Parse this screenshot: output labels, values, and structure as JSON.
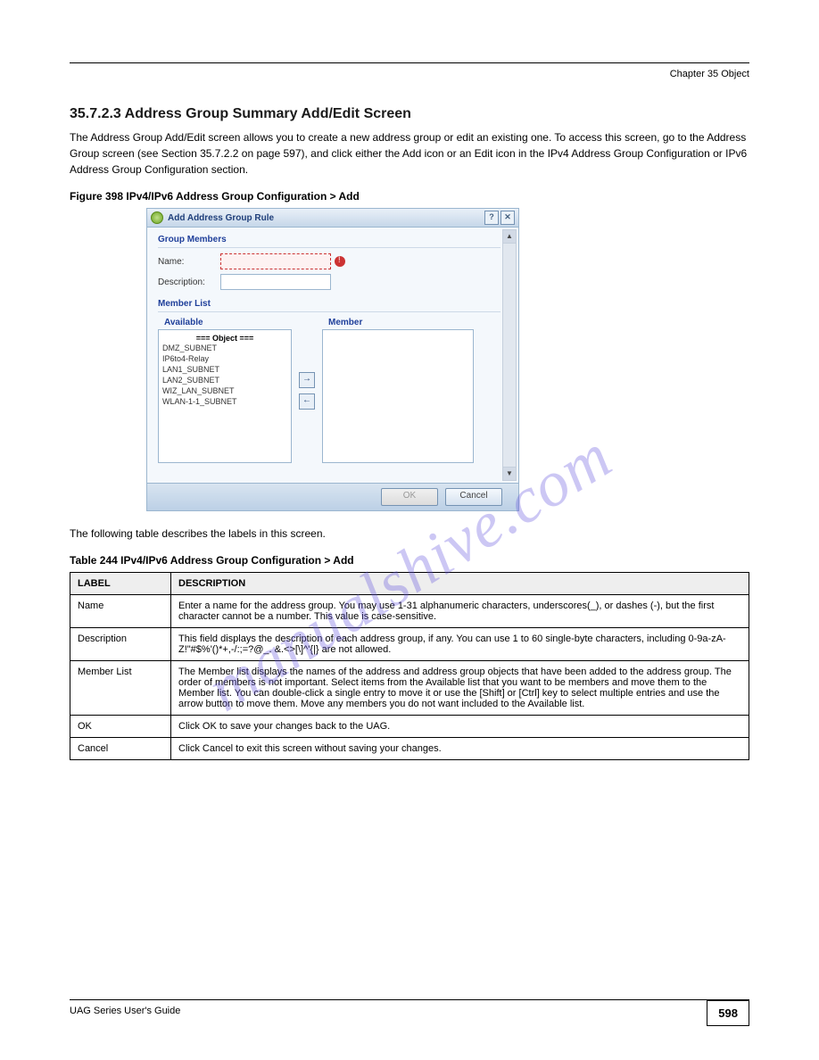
{
  "header": {
    "chapter": "Chapter 35 Object"
  },
  "section": {
    "heading": "35.7.2.3  Address Group Summary Add/Edit Screen",
    "intro": "The Address Group Add/Edit screen allows you to create a new address group or edit an existing one. To access this screen, go to the Address Group screen (see Section 35.7.2.2 on page 597), and click either the Add icon or an Edit icon in the IPv4 Address Group Configuration or IPv6 Address Group Configuration section."
  },
  "figure": {
    "caption": "Figure 398   IPv4/IPv6 Address Group Configuration > Add"
  },
  "dialog": {
    "title": "Add Address Group Rule",
    "groupMembersLabel": "Group Members",
    "nameLabel": "Name:",
    "descLabel": "Description:",
    "memberListLabel": "Member List",
    "availableLabel": "Available",
    "memberLabel": "Member",
    "objectDivider": "=== Object ===",
    "available": [
      "DMZ_SUBNET",
      "IP6to4-Relay",
      "LAN1_SUBNET",
      "LAN2_SUBNET",
      "WIZ_LAN_SUBNET",
      "WLAN-1-1_SUBNET"
    ],
    "okLabel": "OK",
    "cancelLabel": "Cancel"
  },
  "tableIntro": "The following table describes the labels in this screen.",
  "table": {
    "caption": "Table 244   IPv4/IPv6 Address Group Configuration > Add",
    "headers": [
      "LABEL",
      "DESCRIPTION"
    ],
    "rows": [
      {
        "label": "Name",
        "desc": "Enter a name for the address group. You may use 1-31 alphanumeric characters, underscores(_), or dashes (-), but the first character cannot be a number. This value is case-sensitive."
      },
      {
        "label": "Description",
        "desc": "This field displays the description of each address group, if any. You can use 1 to 60 single-byte characters, including 0-9a-zA-Z!\"#$%'()*+,-/:;=?@_. &.<>[\\]^'{|} are not allowed."
      },
      {
        "label": "Member List",
        "desc": "The Member list displays the names of the address and address group objects that have been added to the address group. The order of members is not important. Select items from the Available list that you want to be members and move them to the Member list. You can double-click a single entry to move it or use the [Shift] or [Ctrl] key to select multiple entries and use the arrow button to move them. Move any members you do not want included to the Available list."
      },
      {
        "label": "OK",
        "desc": "Click OK to save your changes back to the UAG."
      },
      {
        "label": "Cancel",
        "desc": "Click Cancel to exit this screen without saving your changes."
      }
    ]
  },
  "watermark": "manualshive.com",
  "footer": {
    "text": "UAG Series User's Guide",
    "page": "598"
  }
}
